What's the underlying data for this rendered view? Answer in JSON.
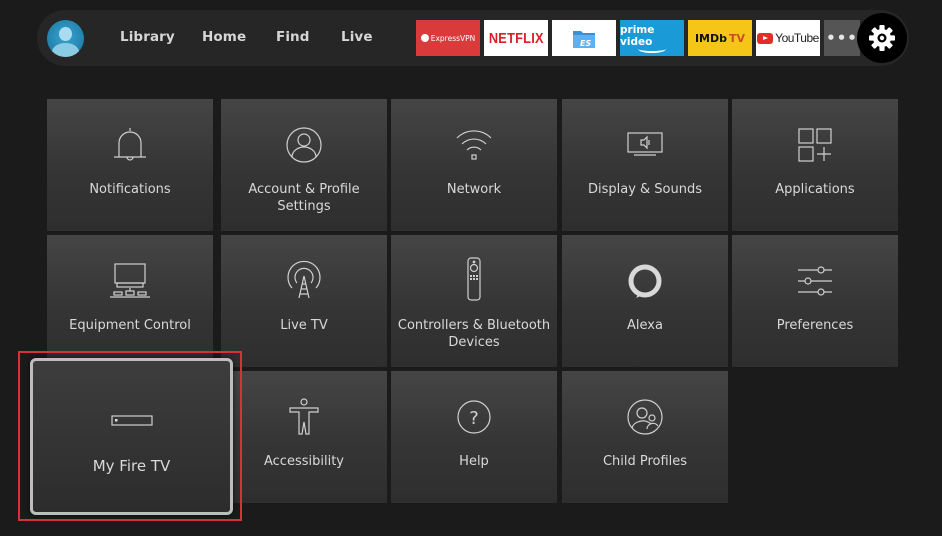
{
  "navbar": {
    "profile_icon": "user-avatar-icon",
    "links": [
      "Library",
      "Home",
      "Find",
      "Live"
    ],
    "apps": [
      {
        "name": "ExpressVPN",
        "label": "ExpressVPN",
        "color": "#da3a3a"
      },
      {
        "name": "Netflix",
        "label": "NETFLIX",
        "color": "#ffffff"
      },
      {
        "name": "ES File Explorer",
        "label": "ES",
        "color": "#ffffff"
      },
      {
        "name": "Prime Video",
        "label": "prime video",
        "color": "#1a9ad6"
      },
      {
        "name": "IMDb TV",
        "label": "IMDb",
        "label_suffix": "TV",
        "color": "#f5c518"
      },
      {
        "name": "YouTube",
        "label": "YouTube",
        "color": "#ffffff"
      }
    ],
    "more_label": "•••",
    "settings_icon": "gear-icon"
  },
  "settings": {
    "tiles": [
      {
        "label": "Notifications",
        "icon": "bell-icon"
      },
      {
        "label": "Account & Profile Settings",
        "icon": "account-circle-icon"
      },
      {
        "label": "Network",
        "icon": "wifi-icon"
      },
      {
        "label": "Display & Sounds",
        "icon": "display-speaker-icon"
      },
      {
        "label": "Applications",
        "icon": "apps-grid-icon"
      },
      {
        "label": "Equipment Control",
        "icon": "tv-equipment-icon"
      },
      {
        "label": "Live TV",
        "icon": "antenna-icon"
      },
      {
        "label": "Controllers & Bluetooth Devices",
        "icon": "remote-icon"
      },
      {
        "label": "Alexa",
        "icon": "alexa-ring-icon"
      },
      {
        "label": "Preferences",
        "icon": "sliders-icon"
      },
      {
        "label": "My Fire TV",
        "icon": "fire-tv-device-icon",
        "focused": true
      },
      {
        "label": "Accessibility",
        "icon": "accessibility-icon"
      },
      {
        "label": "Help",
        "icon": "help-icon"
      },
      {
        "label": "Child Profiles",
        "icon": "child-profiles-icon"
      }
    ],
    "highlight_color": "#d3343a"
  }
}
